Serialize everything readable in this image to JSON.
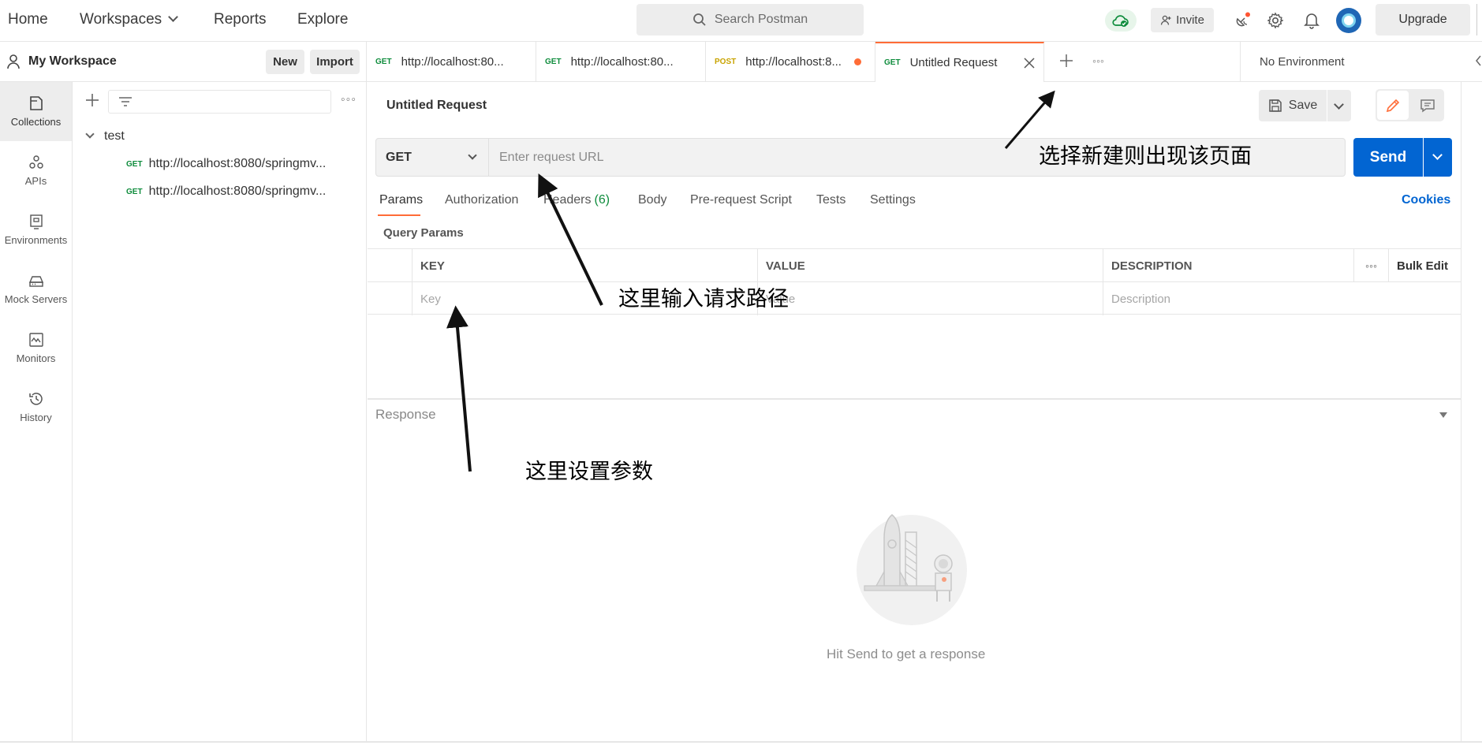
{
  "topbar": {
    "nav": [
      "Home",
      "Workspaces",
      "Reports",
      "Explore"
    ],
    "search_placeholder": "Search Postman",
    "invite": "Invite",
    "upgrade": "Upgrade"
  },
  "workspace": {
    "title": "My Workspace",
    "new_label": "New",
    "import_label": "Import"
  },
  "rail": [
    {
      "label": "Collections",
      "icon": "collections-icon"
    },
    {
      "label": "APIs",
      "icon": "apis-icon"
    },
    {
      "label": "Environments",
      "icon": "environments-icon"
    },
    {
      "label": "Mock Servers",
      "icon": "mock-servers-icon"
    },
    {
      "label": "Monitors",
      "icon": "monitors-icon"
    },
    {
      "label": "History",
      "icon": "history-icon"
    }
  ],
  "collections": {
    "folder": "test",
    "requests": [
      {
        "method": "GET",
        "url": "http://localhost:8080/springmv..."
      },
      {
        "method": "GET",
        "url": "http://localhost:8080/springmv..."
      }
    ]
  },
  "tabs": [
    {
      "method": "GET",
      "label": "http://localhost:80...",
      "unsaved": false
    },
    {
      "method": "GET",
      "label": "http://localhost:80...",
      "unsaved": false
    },
    {
      "method": "POST",
      "label": "http://localhost:8...",
      "unsaved": true
    },
    {
      "method": "GET",
      "label": "Untitled Request",
      "unsaved": false,
      "active": true
    }
  ],
  "environment": "No Environment",
  "request": {
    "title": "Untitled Request",
    "save_label": "Save",
    "method": "GET",
    "url_placeholder": "Enter request URL",
    "send_label": "Send",
    "tabs": [
      "Params",
      "Authorization",
      "Headers",
      "Body",
      "Pre-request Script",
      "Tests",
      "Settings"
    ],
    "headers_count": "(6)",
    "cookies_label": "Cookies",
    "query_params_label": "Query Params"
  },
  "params_table": {
    "headers": [
      "KEY",
      "VALUE",
      "DESCRIPTION"
    ],
    "bulk_edit": "Bulk Edit",
    "placeholders": {
      "key": "Key",
      "value": "Value",
      "description": "Description"
    }
  },
  "response": {
    "label": "Response",
    "empty_text": "Hit Send to get a response"
  },
  "annotations": [
    "选择新建则出现该页面",
    "这里输入请求路径",
    "这里设置参数"
  ],
  "colors": {
    "accent": "#ff6c37",
    "send": "#0265d2",
    "get": "#0e8c3c",
    "post": "#c8a300"
  }
}
